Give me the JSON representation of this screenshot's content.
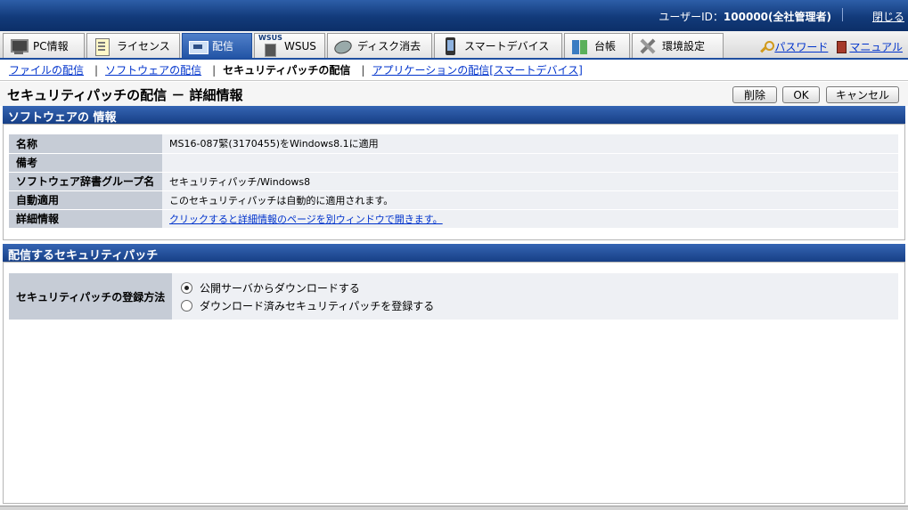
{
  "header": {
    "user_label": "ユーザーID：",
    "user_value": "100000(全社管理者)",
    "close_link": "閉じる"
  },
  "tabs": [
    {
      "label": "PC情報",
      "icon": "pc-icon"
    },
    {
      "label": "ライセンス",
      "icon": "license-icon"
    },
    {
      "label": "配信",
      "icon": "distribution-icon",
      "active": true
    },
    {
      "label": "WSUS",
      "icon": "wsus-server-icon"
    },
    {
      "label": "ディスク消去",
      "icon": "disk-erase-icon"
    },
    {
      "label": "スマートデバイス",
      "icon": "smartphone-icon"
    },
    {
      "label": "台帳",
      "icon": "ledger-book-icon"
    },
    {
      "label": "環境設定",
      "icon": "tools-icon"
    }
  ],
  "tab_links": {
    "password": "パスワード",
    "manual": "マニュアル"
  },
  "subnav": {
    "file": "ファイルの配信",
    "software": "ソフトウェアの配信",
    "security": "セキュリティパッチの配信",
    "application": "アプリケーションの配信[スマートデバイス]"
  },
  "page": {
    "title": "セキュリティパッチの配信 － 詳細情報",
    "delete_button": "削除",
    "ok_button": "OK",
    "cancel_button": "キャンセル"
  },
  "software_info": {
    "heading": "ソフトウェアの 情報",
    "rows": [
      {
        "key": "名称",
        "value": "MS16-087緊(3170455)をWindows8.1に適用"
      },
      {
        "key": "備考",
        "value": ""
      },
      {
        "key": "ソフトウェア辞書グループ名",
        "value": "セキュリティパッチ/Windows8"
      },
      {
        "key": "自動適用",
        "value": "このセキュリティパッチは自動的に適用されます。"
      },
      {
        "key": "詳細情報",
        "value": "クリックすると詳細情報のページを別ウィンドウで開きます。"
      }
    ]
  },
  "distribute": {
    "heading": "配信するセキュリティパッチ",
    "method_label": "セキュリティパッチの登録方法",
    "options": [
      {
        "label": "公開サーバからダウンロードする",
        "selected": true
      },
      {
        "label": "ダウンロード済みセキュリティパッチを登録する",
        "selected": false
      }
    ]
  }
}
